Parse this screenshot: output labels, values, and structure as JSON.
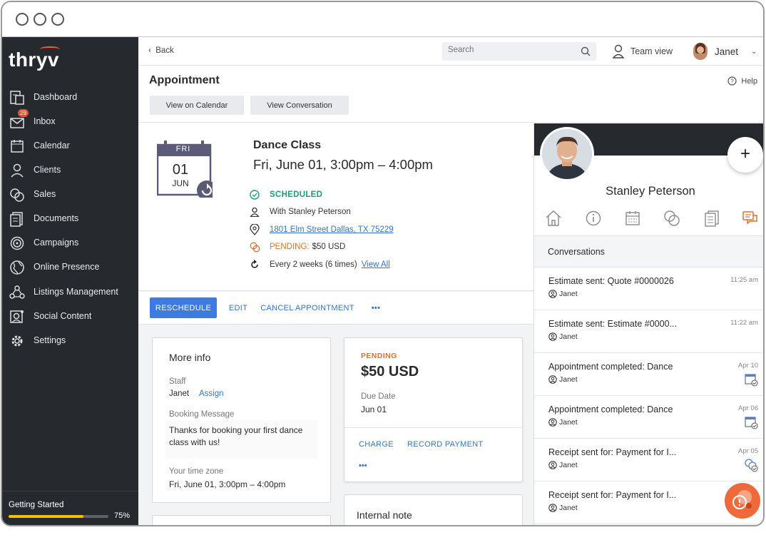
{
  "app": {
    "logo_text": "thryv",
    "brand_accent": "#ff5a2a"
  },
  "sidebar": {
    "items": [
      {
        "label": "Dashboard",
        "icon": "dashboard-icon"
      },
      {
        "label": "Inbox",
        "icon": "inbox-icon",
        "badge": "29"
      },
      {
        "label": "Calendar",
        "icon": "calendar-icon"
      },
      {
        "label": "Clients",
        "icon": "clients-icon"
      },
      {
        "label": "Sales",
        "icon": "sales-icon"
      },
      {
        "label": "Documents",
        "icon": "documents-icon"
      },
      {
        "label": "Campaigns",
        "icon": "campaigns-icon"
      },
      {
        "label": "Online Presence",
        "icon": "globe-icon"
      },
      {
        "label": "Listings Management",
        "icon": "listings-icon"
      },
      {
        "label": "Social Content",
        "icon": "social-icon"
      },
      {
        "label": "Settings",
        "icon": "gear-icon"
      }
    ],
    "getting_started": {
      "label": "Getting Started",
      "progress": 0.75,
      "percent_text": "75%"
    }
  },
  "topbar": {
    "back_label": "Back",
    "search_placeholder": "Search",
    "team_view_label": "Team view",
    "user_name": "Janet"
  },
  "page": {
    "title": "Appointment",
    "help_label": "Help",
    "view_calendar_label": "View on Calendar",
    "view_conversation_label": "View Conversation"
  },
  "appointment": {
    "calendar_day": "FRI",
    "calendar_date": "01",
    "calendar_month": "JUN",
    "name": "Dance Class",
    "datetime": "Fri, June 01, 3:00pm – 4:00pm",
    "status": "SCHEDULED",
    "with": "With Stanley Peterson",
    "address": "1801 Elm Street Dallas, TX 75229",
    "payment_status": "PENDING:",
    "payment_amount": "$50 USD",
    "recurrence": "Every 2 weeks (6 times)",
    "view_all_label": "View All"
  },
  "actions": {
    "reschedule": "RESCHEDULE",
    "edit": "EDIT",
    "cancel": "CANCEL APPOINTMENT",
    "more": "•••"
  },
  "more_info": {
    "title": "More info",
    "staff_label": "Staff",
    "staff_value": "Janet",
    "assign_label": "Assign",
    "booking_label": "Booking Message",
    "booking_message": "Thanks for booking your first dance class with us!",
    "timezone_label": "Your time zone",
    "timezone_value": "Fri, June 01, 3:00pm – 4:00pm"
  },
  "payment": {
    "status": "PENDING",
    "amount": "$50 USD",
    "due_label": "Due Date",
    "due_value": "Jun 01",
    "charge_label": "CHARGE",
    "record_label": "RECORD PAYMENT",
    "more": "•••"
  },
  "internal_note": {
    "title": "Internal note"
  },
  "client_panel": {
    "name": "Stanley Peterson",
    "add_label": "+",
    "tabs": [
      "home-icon",
      "info-icon",
      "calendar-icon",
      "sales-icon",
      "documents-icon",
      "conversations-icon"
    ],
    "conversations_title": "Conversations",
    "conversations": [
      {
        "title": "Estimate sent: Quote #0000026",
        "user": "Janet",
        "time": "11:25 am",
        "icon": ""
      },
      {
        "title": "Estimate sent: Estimate #0000...",
        "user": "Janet",
        "time": "11:22 am",
        "icon": ""
      },
      {
        "title": "Appointment completed: Dance",
        "user": "Janet",
        "time": "Apr 10",
        "icon": "calendar-check-icon"
      },
      {
        "title": "Appointment completed: Dance",
        "user": "Janet",
        "time": "Apr 06",
        "icon": "calendar-check-icon"
      },
      {
        "title": "Receipt sent for: Payment for I...",
        "user": "Janet",
        "time": "Apr 05",
        "icon": "payment-check-icon"
      },
      {
        "title": "Receipt sent for: Payment for I...",
        "user": "Janet",
        "time": "",
        "icon": ""
      }
    ]
  },
  "colors": {
    "sidebar_bg": "#26292e",
    "primary_blue": "#3d7be0",
    "scheduled_green": "#1aa179",
    "pending_orange": "#e36f2d"
  }
}
